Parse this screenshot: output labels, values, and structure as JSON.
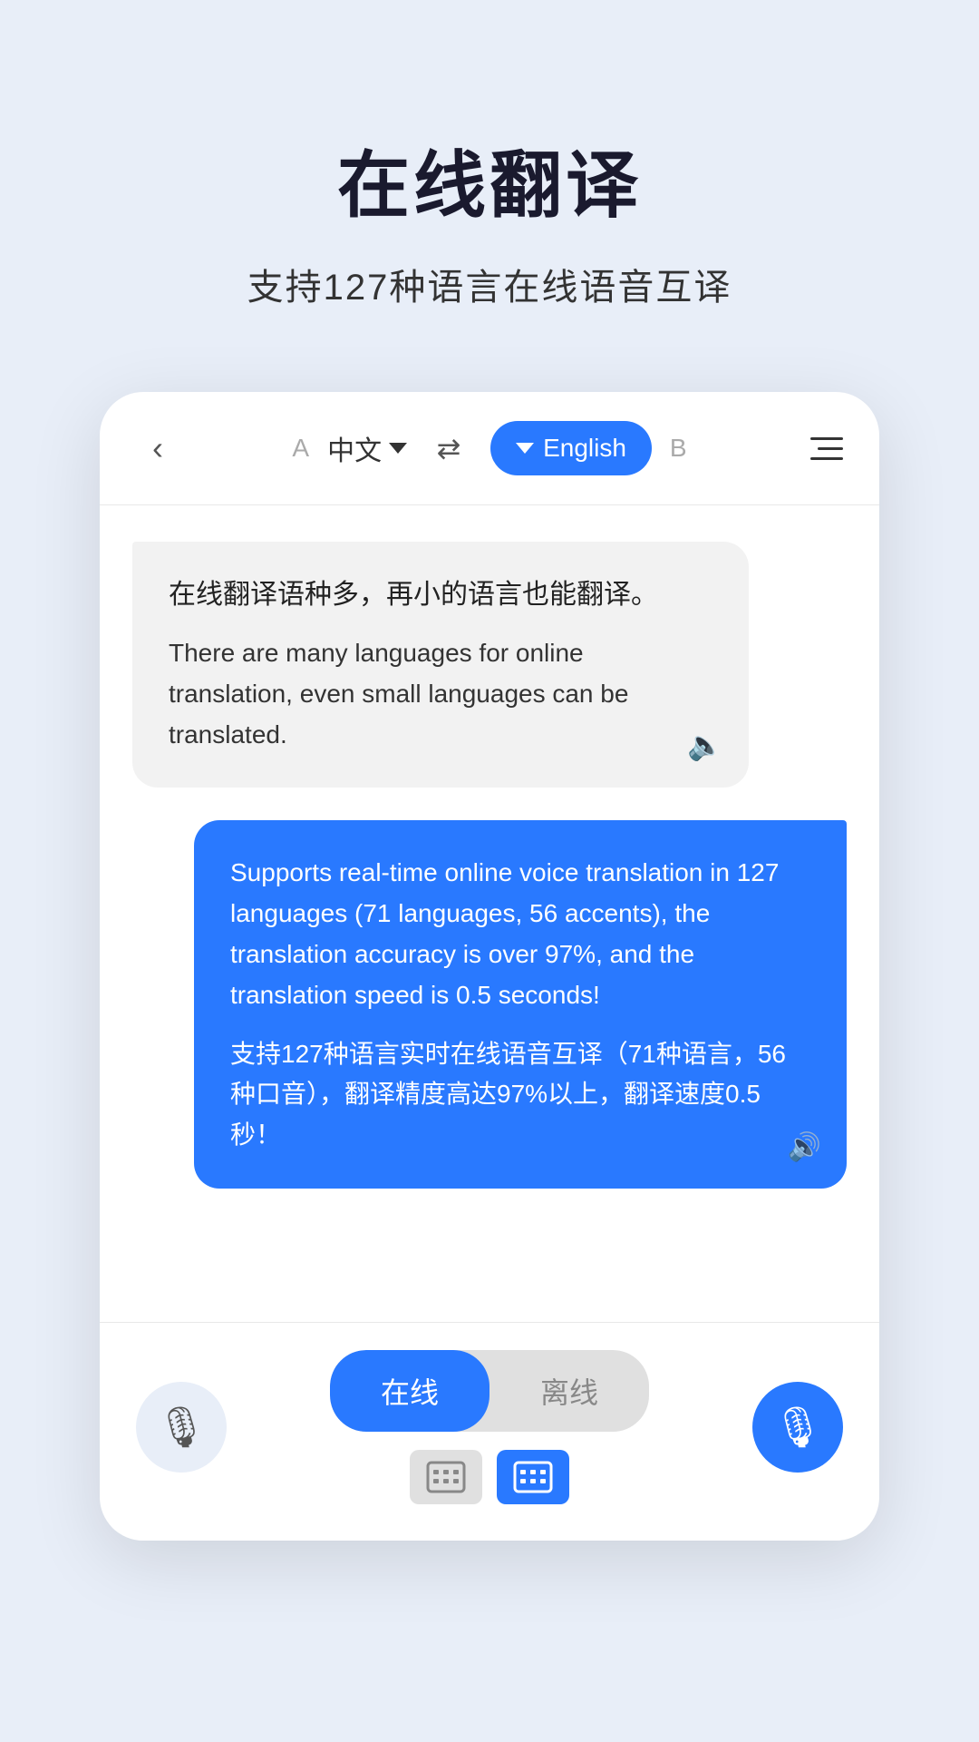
{
  "header": {
    "title": "在线翻译",
    "subtitle": "支持127种语言在线语音互译"
  },
  "topbar": {
    "back_label": "<",
    "lang_a_label": "A",
    "lang_chinese": "中文",
    "swap_label": "⇄",
    "lang_english": "English",
    "lang_b_label": "B"
  },
  "chat": {
    "bubble_left_chinese": "在线翻译语种多，再小的语言也能翻译。",
    "bubble_left_english": "There are many languages for online translation, even small languages can be translated.",
    "bubble_right_english": "Supports real-time online voice translation in 127 languages (71 languages, 56 accents), the translation accuracy is over 97%, and the translation speed is 0.5 seconds!",
    "bubble_right_chinese": "支持127种语言实时在线语音互译（71种语言，56种口音），翻译精度高达97%以上，翻译速度0.5秒！"
  },
  "bottom": {
    "online_label": "在线",
    "offline_label": "离线"
  }
}
